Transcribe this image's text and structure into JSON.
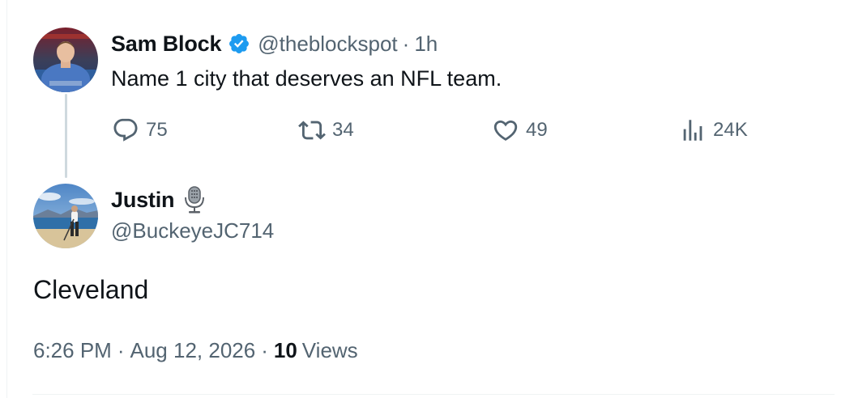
{
  "parent_tweet": {
    "author_name": "Sam Block",
    "author_handle": "@theblockspot",
    "separator": "·",
    "time_ago": "1h",
    "text": "Name 1 city that deserves an NFL team.",
    "verified": true,
    "actions": {
      "reply_count": "75",
      "retweet_count": "34",
      "like_count": "49",
      "views_count": "24K"
    }
  },
  "reply_tweet": {
    "author_name": "Justin",
    "author_handle": "@BuckeyeJC714",
    "name_emoji": "microphone-icon",
    "text": "Cleveland",
    "time": "6:26 PM",
    "separator": "·",
    "date": "Aug 12, 2026",
    "views_count": "10",
    "views_label": "Views"
  },
  "colors": {
    "primary_text": "#0f1419",
    "secondary_text": "#536471",
    "verified_blue": "#1d9bf0",
    "thread_line": "#cfd9de"
  }
}
